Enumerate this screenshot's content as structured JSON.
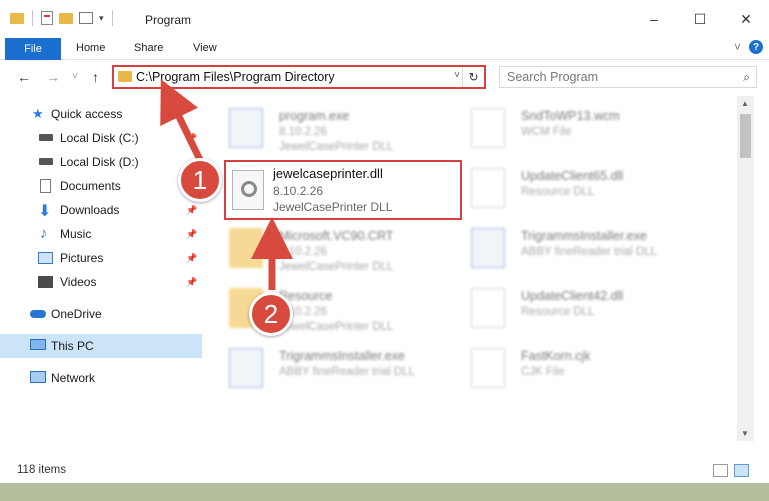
{
  "window": {
    "title": "Program",
    "minimize": "–",
    "maximize": "☐",
    "close": "✕"
  },
  "ribbon": {
    "file": "File",
    "tabs": [
      "Home",
      "Share",
      "View"
    ],
    "expand": "˅",
    "help": "?"
  },
  "nav": {
    "back": "←",
    "forward": "→",
    "recent": "˅",
    "up": "↑",
    "address": "C:\\Program Files\\Program Directory",
    "address_dropdown": "˅",
    "refresh": "↻",
    "search_placeholder": "Search Program",
    "search_icon": "⌕"
  },
  "sidebar": {
    "items": [
      {
        "label": "Quick access",
        "icon": "star-icon",
        "pinned": false
      },
      {
        "label": "Local Disk (C:)",
        "icon": "drive-icon",
        "pinned": true
      },
      {
        "label": "Local Disk (D:)",
        "icon": "drive-icon",
        "pinned": false
      },
      {
        "label": "Documents",
        "icon": "documents-icon",
        "pinned": true
      },
      {
        "label": "Downloads",
        "icon": "download-icon",
        "pinned": true
      },
      {
        "label": "Music",
        "icon": "music-icon",
        "pinned": true
      },
      {
        "label": "Pictures",
        "icon": "pictures-icon",
        "pinned": true
      },
      {
        "label": "Videos",
        "icon": "videos-icon",
        "pinned": true
      },
      {
        "label": "OneDrive",
        "icon": "cloud-icon",
        "pinned": false
      },
      {
        "label": "This PC",
        "icon": "computer-icon",
        "pinned": false
      },
      {
        "label": "Network",
        "icon": "network-icon",
        "pinned": false
      }
    ],
    "pin": "📌"
  },
  "files": {
    "left": [
      {
        "name": "program.exe",
        "version": "8.10.2.26",
        "desc": "JewelCasePrinter DLL",
        "icon": "app-icon"
      },
      {
        "name": "jewelcaseprinter.dll",
        "version": "8.10.2.26",
        "desc": "JewelCasePrinter DLL",
        "icon": "dll-icon"
      },
      {
        "name": "Microsoft.VC90.CRT",
        "version": "8.10.2.26",
        "desc": "JewelCasePrinter DLL",
        "icon": "folder-icon"
      },
      {
        "name": "Resource",
        "version": "8.10.2.26",
        "desc": "JewelCasePrinter DLL",
        "icon": "folder-icon"
      },
      {
        "name": "TrigrammsInstaller.exe",
        "version": "",
        "desc": "ABBY fineReader trial DLL",
        "icon": "app-icon"
      }
    ],
    "right": [
      {
        "name": "SndToWP13.wcm",
        "version": "",
        "desc": "WCM File",
        "icon": "file-icon"
      },
      {
        "name": "UpdateClient65.dll",
        "version": "",
        "desc": "Resource DLL",
        "icon": "dll-icon"
      },
      {
        "name": "TrigrammsInstaller.exe",
        "version": "",
        "desc": "ABBY fineReader trial DLL",
        "icon": "app-icon"
      },
      {
        "name": "UpdateClient42.dll",
        "version": "",
        "desc": "Resource DLL",
        "icon": "dll-icon"
      },
      {
        "name": "FastKorn.cjk",
        "version": "",
        "desc": "CJK File",
        "icon": "file-icon"
      }
    ]
  },
  "annotations": {
    "badge1": "1",
    "badge2": "2"
  },
  "status": {
    "items": "118 items"
  },
  "colors": {
    "accent": "#1a6fd0",
    "highlight": "#d54040",
    "badge": "#d84a3e",
    "selected": "#cce4f7"
  }
}
